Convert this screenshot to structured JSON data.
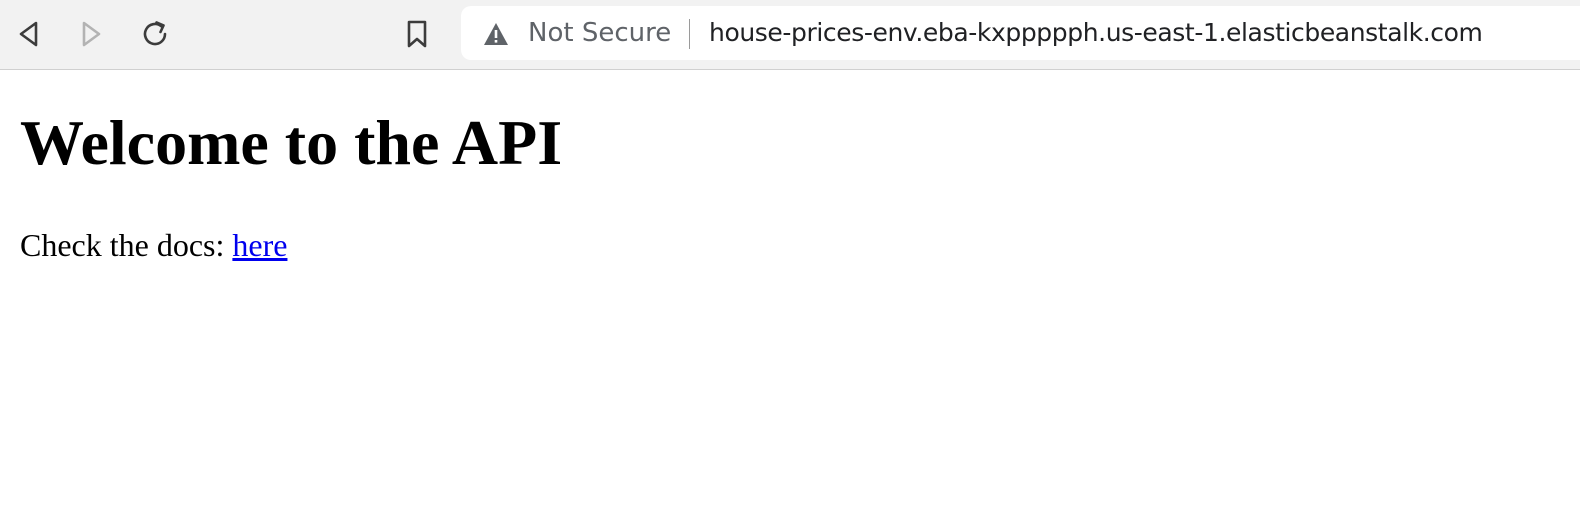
{
  "toolbar": {
    "back_icon": "back-arrow-icon",
    "forward_icon": "forward-arrow-icon",
    "reload_icon": "reload-icon",
    "bookmark_icon": "bookmark-icon"
  },
  "address_bar": {
    "security_icon": "warning-icon",
    "security_label": "Not Secure",
    "url": "house-prices-env.eba-kxppppph.us-east-1.elasticbeanstalk.com"
  },
  "page": {
    "heading": "Welcome to the API",
    "docs_prefix": "Check the docs: ",
    "docs_link": "here"
  },
  "colors": {
    "toolbar_bg": "#f2f2f2",
    "link": "#0000ee",
    "secondary_text": "#5f6368"
  }
}
